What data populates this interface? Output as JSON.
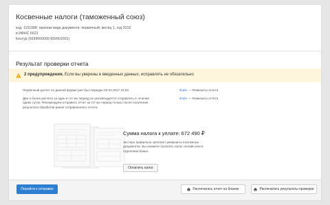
{
  "page": {
    "title": "Косвенные налоги (таможенный союз)",
    "meta": [
      "код: 1151088: признак вида документа: первичный; месяц 1, год 2016",
      "в ИФНС 6623",
      "Контур (6699000000-669901001)"
    ]
  },
  "result": {
    "section_title": "Результат проверки отчета",
    "warning_count": "2 предупреждения.",
    "warning_text": " Если вы уверены в введенных данных, исправлять не обязательно",
    "messages": [
      {
        "text": "Первичный расчет по данной форме уже был передан 02.03.2017 16:53",
        "file": "Файл",
        "link": " — Реквизиты отчета"
      },
      {
        "text": "Два и более расчета за один и тот же период не рекомендуется отправлять в течение одних суток. Рекомендуем отправить отчет за тот же период только после получения результата обработки ранее отправленного отчета.",
        "file": "Файл",
        "link": " — Реквизиты отчета"
      }
    ]
  },
  "tax": {
    "title": "Сумма налога к уплате: 672 490 ₽",
    "description": "Экстерн правильно заполнит реквизиты платежных документов. Вы сможете оплатить налог онлайн или в отделении банка.",
    "pay_button": "Оплатить налог"
  },
  "footer": {
    "go_to_send": "Перейти к отправке",
    "print_blank": "Распечатать отчет на бланке",
    "print_results": "Распечатать результаты проверки"
  },
  "colors": {
    "accent": "#2e7fd2",
    "warning_bg": "#fdf6dc",
    "warning_icon": "#f0a500"
  },
  "icons": [
    "warning-icon",
    "printer-icon",
    "document-illustration"
  ]
}
